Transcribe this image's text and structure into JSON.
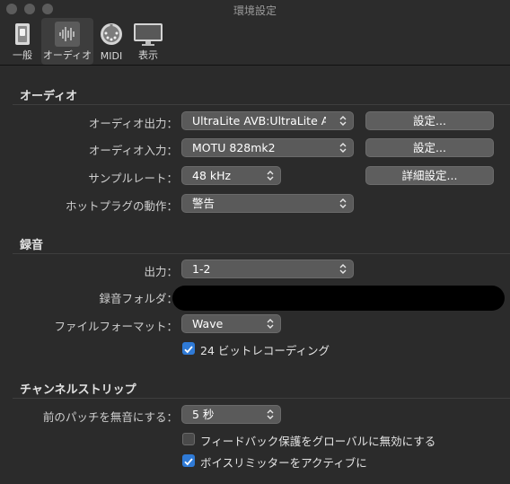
{
  "window": {
    "title": "環境設定"
  },
  "toolbar": {
    "tabs": [
      {
        "label": "一般"
      },
      {
        "label": "オーディオ",
        "selected": true
      },
      {
        "label": "MIDI"
      },
      {
        "label": "表示"
      }
    ]
  },
  "audio": {
    "section_title": "オーディオ",
    "output_label": "オーディオ出力：",
    "output_value": "UltraLite AVB:UltraLite AVB",
    "output_settings_btn": "設定...",
    "input_label": "オーディオ入力：",
    "input_value": "MOTU 828mk2",
    "input_settings_btn": "設定...",
    "sample_rate_label": "サンプルレート：",
    "sample_rate_value": "48 kHz",
    "advanced_btn": "詳細設定...",
    "hotplug_label": "ホットプラグの動作：",
    "hotplug_value": "警告"
  },
  "recording": {
    "section_title": "録音",
    "output_label": "出力：",
    "output_value": "1-2",
    "folder_label": "録音フォルダ：",
    "format_label": "ファイルフォーマット：",
    "format_value": "Wave",
    "bit24_label": "24 ビットレコーディング",
    "bit24_checked": true
  },
  "channel_strip": {
    "section_title": "チャンネルストリップ",
    "mute_label": "前のパッチを無音にする：",
    "mute_value": "5 秒",
    "feedback_label": "フィードバック保護をグローバルに無効にする",
    "feedback_checked": false,
    "limiter_label": "ボイスリミッターをアクティブに",
    "limiter_checked": true
  },
  "colors": {
    "accent": "#2f7ad6",
    "pane": "#2b2b2b",
    "control": "#5a5a5a"
  }
}
